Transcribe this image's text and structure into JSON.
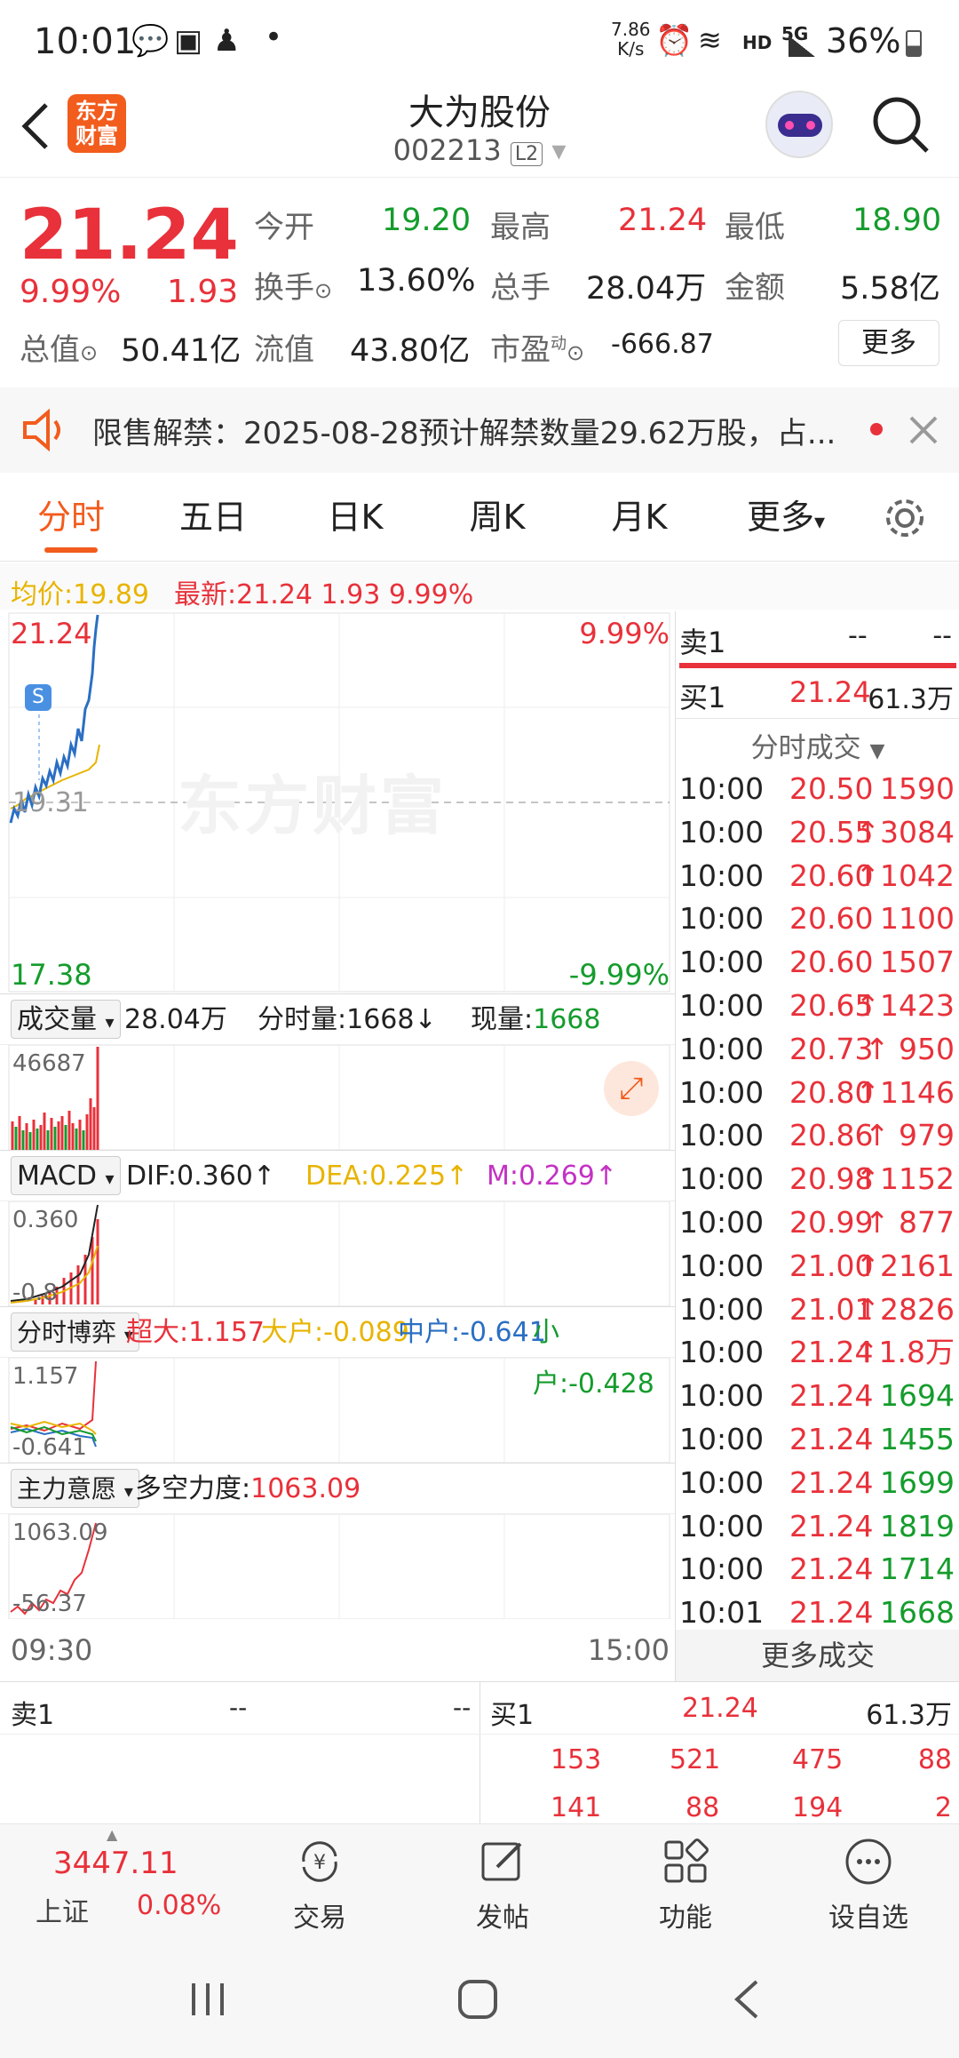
{
  "status": {
    "time": "10:01",
    "net_speed_top": "7.86",
    "net_speed_bottom": "K/s",
    "hd": "HD",
    "network": "5G",
    "battery": "36%"
  },
  "header": {
    "logo_top": "东方",
    "logo_bottom": "财富",
    "title": "大为股份",
    "code": "002213",
    "badge": "L2"
  },
  "quote": {
    "price": "21.24",
    "pct": "9.99%",
    "change": "1.93",
    "open_label": "今开",
    "open": "19.20",
    "high_label": "最高",
    "high": "21.24",
    "low_label": "最低",
    "low": "18.90",
    "turnover_label": "换手",
    "turnover": "13.60%",
    "volume_label": "总手",
    "volume": "28.04万",
    "amount_label": "金额",
    "amount": "5.58亿",
    "mktcap_label": "总值",
    "mktcap": "50.41亿",
    "float_label": "流值",
    "float": "43.80亿",
    "pe_label": "市盈",
    "pe_sup": "动",
    "pe": "-666.87",
    "more": "更多"
  },
  "notice": {
    "text": "限售解禁：2025-08-28预计解禁数量29.62万股，占..."
  },
  "tabs": [
    "分时",
    "五日",
    "日K",
    "周K",
    "月K",
    "更多"
  ],
  "avg": {
    "avg_label": "均价:",
    "avg": "19.89",
    "latest_label": "最新:",
    "latest": "21.24",
    "chg": "1.93",
    "pct": "9.99%"
  },
  "chart": {
    "top_price": "21.24",
    "top_pct": "9.99%",
    "mid_price": "19.31",
    "bottom_price": "17.38",
    "bottom_pct": "-9.99%",
    "watermark": "东方财富",
    "marker": "S",
    "vol_label": "成交量",
    "vol_total": "28.04万",
    "vol_min_label": "分时量:",
    "vol_min": "1668↓",
    "vol_now_label": "现量:",
    "vol_now": "1668",
    "vol_max": "46687",
    "macd_label": "MACD",
    "dif": "DIF:0.360↑",
    "dea": "DEA:0.225↑",
    "m": "M:0.269↑",
    "macd_top": "0.360",
    "macd_bottom": "-0.8",
    "game_label": "分时博弈",
    "super_label": "超大:",
    "super": "1.157",
    "big_label": "大户:",
    "big": "-0.089",
    "mid_label": "中户:",
    "mid": "-0.641",
    "small_label": "小户:",
    "small": "-0.428",
    "game_top": "1.157",
    "game_bottom": "-0.641",
    "intent_label": "主力意愿",
    "force_label": "多空力度:",
    "force": "1063.09",
    "intent_top": "1063.09",
    "intent_bottom": "-56.37",
    "time_start": "09:30",
    "time_end": "15:00"
  },
  "tradelist": {
    "sell1_label": "卖1",
    "sell1_price": "--",
    "sell1_vol": "--",
    "buy1_label": "买1",
    "buy1_price": "21.24",
    "buy1_vol": "61.3万",
    "title": "分时成交",
    "more": "更多成交",
    "rows": [
      {
        "t": "10:00",
        "p": "20.50",
        "a": "1590"
      },
      {
        "t": "10:00",
        "p": "20.55",
        "a": "↑3084"
      },
      {
        "t": "10:00",
        "p": "20.60",
        "a": "↑1042"
      },
      {
        "t": "10:00",
        "p": "20.60",
        "a": "1100"
      },
      {
        "t": "10:00",
        "p": "20.60",
        "a": "1507"
      },
      {
        "t": "10:00",
        "p": "20.65",
        "a": "↑1423"
      },
      {
        "t": "10:00",
        "p": "20.73",
        "a": "↑ 950"
      },
      {
        "t": "10:00",
        "p": "20.80",
        "a": "↑1146"
      },
      {
        "t": "10:00",
        "p": "20.86",
        "a": "↑ 979"
      },
      {
        "t": "10:00",
        "p": "20.98",
        "a": "↑1152"
      },
      {
        "t": "10:00",
        "p": "20.99",
        "a": "↑ 877"
      },
      {
        "t": "10:00",
        "p": "21.00",
        "a": "↑2161"
      },
      {
        "t": "10:00",
        "p": "21.01",
        "a": "↑2826"
      },
      {
        "t": "10:00",
        "p": "21.24",
        "a": "↑1.8万"
      },
      {
        "t": "10:00",
        "p": "21.24",
        "a": "1694"
      },
      {
        "t": "10:00",
        "p": "21.24",
        "a": "1455"
      },
      {
        "t": "10:00",
        "p": "21.24",
        "a": "1699"
      },
      {
        "t": "10:00",
        "p": "21.24",
        "a": "1819"
      },
      {
        "t": "10:00",
        "p": "21.24",
        "a": "1714"
      },
      {
        "t": "10:01",
        "p": "21.24",
        "a": "1668"
      }
    ]
  },
  "orderbook": {
    "sell1_label": "卖1",
    "sell1_price": "--",
    "sell1_vol": "--",
    "buy1_label": "买1",
    "buy1_price": "21.24",
    "buy1_vol": "61.3万",
    "row1": [
      "153",
      "521",
      "475",
      "88"
    ],
    "row2": [
      "141",
      "88",
      "194",
      "2"
    ]
  },
  "bottomnav": {
    "index_value": "3447.11",
    "index_name": "上证",
    "index_pct": "0.08%",
    "trade": "交易",
    "post": "发帖",
    "func": "功能",
    "watch": "设自选"
  }
}
